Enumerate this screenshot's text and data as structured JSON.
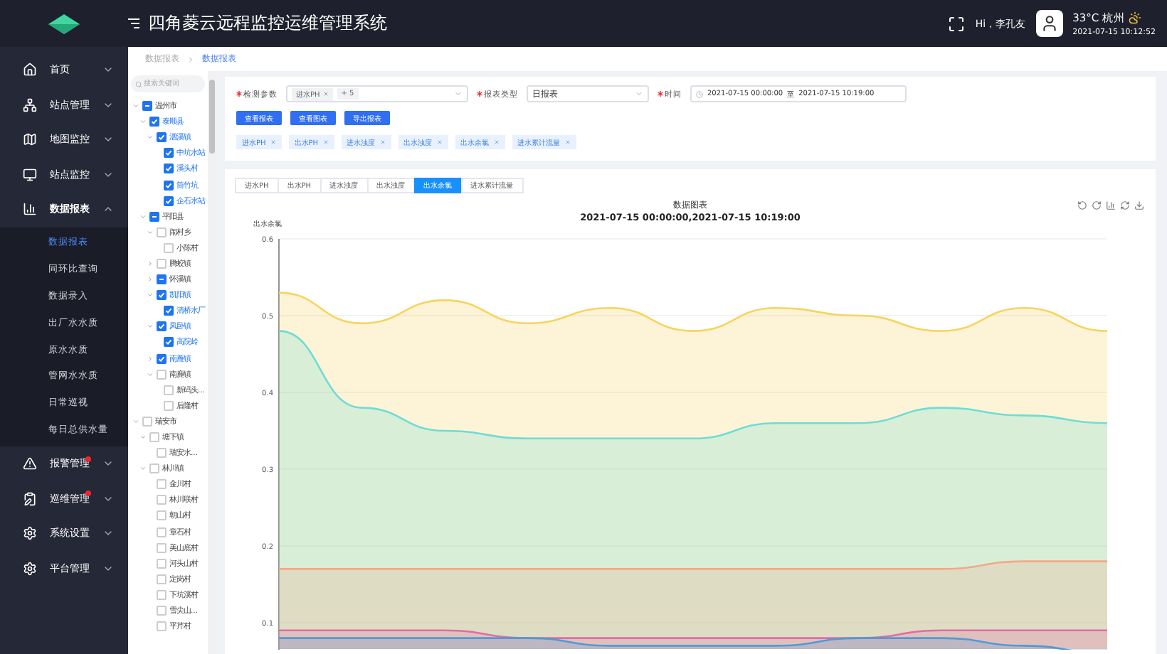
{
  "header": {
    "title": "四角菱云远程监控运维管理系统",
    "greeting": "Hi，李孔友",
    "weather": "33°C 杭州",
    "datetime": "2021-07-15 10:12:52"
  },
  "sidebar": {
    "items": [
      {
        "label": "首页",
        "expanded": false,
        "dot": false
      },
      {
        "label": "站点管理",
        "expanded": false,
        "dot": false
      },
      {
        "label": "地图监控",
        "expanded": false,
        "dot": false
      },
      {
        "label": "站点监控",
        "expanded": false,
        "dot": false
      },
      {
        "label": "数据报表",
        "expanded": true,
        "dot": false,
        "children": [
          {
            "label": "数据报表",
            "selected": true
          },
          {
            "label": "同环比查询",
            "selected": false
          },
          {
            "label": "数据录入",
            "selected": false
          },
          {
            "label": "出厂水水质",
            "selected": false
          },
          {
            "label": "原水水质",
            "selected": false
          },
          {
            "label": "管网水水质",
            "selected": false
          },
          {
            "label": "日常巡视",
            "selected": false
          },
          {
            "label": "每日总供水量",
            "selected": false
          }
        ]
      },
      {
        "label": "报警管理",
        "expanded": false,
        "dot": true
      },
      {
        "label": "巡维管理",
        "expanded": false,
        "dot": true
      },
      {
        "label": "系统设置",
        "expanded": false,
        "dot": false
      },
      {
        "label": "平台管理",
        "expanded": false,
        "dot": false
      }
    ]
  },
  "breadcrumb": [
    "数据报表",
    "数据报表"
  ],
  "tree": {
    "placeholder": "搜索关键词",
    "nodes": [
      {
        "label": "温州市",
        "checked": false,
        "indeterminate": true,
        "expanded": true,
        "children": [
          {
            "label": "泰顺县",
            "checked": true,
            "indeterminate": false,
            "expanded": true,
            "children": [
              {
                "label": "泗溪镇",
                "checked": true,
                "indeterminate": false,
                "expanded": true,
                "children": [
                  {
                    "label": "中坑水站",
                    "checked": true
                  },
                  {
                    "label": "溪头村",
                    "checked": true
                  },
                  {
                    "label": "筒竹坑",
                    "checked": true
                  },
                  {
                    "label": "企石水站",
                    "checked": true
                  }
                ]
              }
            ]
          },
          {
            "label": "平阳县",
            "checked": false,
            "indeterminate": true,
            "expanded": true,
            "children": [
              {
                "label": "闹村乡",
                "checked": false,
                "indeterminate": false,
                "expanded": true,
                "children": [
                  {
                    "label": "小陈村",
                    "checked": false
                  }
                ]
              },
              {
                "label": "腾蛟镇",
                "checked": false,
                "indeterminate": false,
                "expanded": false
              },
              {
                "label": "怀溪镇",
                "checked": false,
                "indeterminate": true,
                "expanded": false
              },
              {
                "label": "凯阳镇",
                "checked": true,
                "indeterminate": false,
                "expanded": true,
                "children": [
                  {
                    "label": "清桥水厂",
                    "checked": true
                  }
                ]
              },
              {
                "label": "凤卧镇",
                "checked": true,
                "indeterminate": false,
                "expanded": true,
                "children": [
                  {
                    "label": "高院岭",
                    "checked": true
                  }
                ]
              },
              {
                "label": "南雁镇",
                "checked": true,
                "indeterminate": false,
                "expanded": false
              },
              {
                "label": "南麂镇",
                "checked": false,
                "indeterminate": false,
                "expanded": true,
                "children": [
                  {
                    "label": "新码头...",
                    "checked": false
                  },
                  {
                    "label": "后隆村",
                    "checked": false
                  }
                ]
              }
            ]
          }
        ]
      },
      {
        "label": "瑞安市",
        "checked": false,
        "indeterminate": false,
        "expanded": true,
        "children": [
          {
            "label": "塘下镇",
            "checked": false,
            "indeterminate": false,
            "expanded": true,
            "children": [
              {
                "label": "瑞安水...",
                "checked": false
              }
            ]
          },
          {
            "label": "林川镇",
            "checked": false,
            "indeterminate": false,
            "expanded": true,
            "children": [
              {
                "label": "金川村",
                "checked": false
              },
              {
                "label": "林川联村",
                "checked": false
              },
              {
                "label": "朝山村",
                "checked": false
              },
              {
                "label": "章石村",
                "checked": false
              },
              {
                "label": "美山底村",
                "checked": false
              },
              {
                "label": "河头山村",
                "checked": false
              },
              {
                "label": "定岗村",
                "checked": false
              },
              {
                "label": "下坑溪村",
                "checked": false
              },
              {
                "label": "雪尖山...",
                "checked": false
              },
              {
                "label": "平芹村",
                "checked": false
              }
            ]
          }
        ]
      }
    ]
  },
  "form": {
    "fields": [
      {
        "kind": "multiselect",
        "label": "检测参数",
        "required": true,
        "tags": [
          "进水PH",
          "+ 5"
        ]
      },
      {
        "kind": "select",
        "label": "报表类型",
        "required": true,
        "value": "日报表"
      },
      {
        "kind": "daterange",
        "label": "时间",
        "required": true,
        "start": "2021-07-15 00:00:00",
        "separator": "至",
        "end": "2021-07-15 10:19:00"
      }
    ]
  },
  "buttons": [
    "查看报表",
    "查看图表",
    "导出报表"
  ],
  "tags": [
    "进水PH",
    "出水PH",
    "进水浊度",
    "出水浊度",
    "出水余氯",
    "进水累计流量"
  ],
  "tabs": [
    {
      "label": "进水PH",
      "selected": false
    },
    {
      "label": "出水PH",
      "selected": false
    },
    {
      "label": "进水浊度",
      "selected": false
    },
    {
      "label": "出水浊度",
      "selected": false
    },
    {
      "label": "出水余氯",
      "selected": true
    },
    {
      "label": "进水累计流量",
      "selected": false
    }
  ],
  "chart": {
    "title": "数据图表",
    "subtitle": "2021-07-15 00:00:00,2021-07-15 10:19:00",
    "chart_data": {
      "type": "area",
      "ylabel": "出水余氯",
      "grid": true,
      "ylim": [
        0.06,
        0.6
      ],
      "yticks": [
        0.1,
        0.2,
        0.3,
        0.4,
        0.5,
        0.6
      ],
      "series": [
        {
          "color": "#f7d460",
          "values": [
            0.53,
            0.49,
            0.52,
            0.49,
            0.51,
            0.48,
            0.51,
            0.5,
            0.48,
            0.51,
            0.48
          ]
        },
        {
          "color": "#6fdcd6",
          "values": [
            0.48,
            0.38,
            0.35,
            0.34,
            0.34,
            0.34,
            0.36,
            0.36,
            0.38,
            0.37,
            0.36
          ]
        },
        {
          "color": "#f2a98a",
          "values": [
            0.17,
            0.17,
            0.17,
            0.17,
            0.17,
            0.17,
            0.17,
            0.17,
            0.17,
            0.18,
            0.18
          ]
        },
        {
          "color": "#e36aa6",
          "values": [
            0.09,
            0.09,
            0.09,
            0.08,
            0.08,
            0.08,
            0.08,
            0.08,
            0.09,
            0.09,
            0.09
          ]
        },
        {
          "color": "#4f9ad8",
          "values": [
            0.08,
            0.08,
            0.08,
            0.08,
            0.07,
            0.07,
            0.07,
            0.08,
            0.08,
            0.07,
            0.06
          ]
        }
      ]
    }
  }
}
